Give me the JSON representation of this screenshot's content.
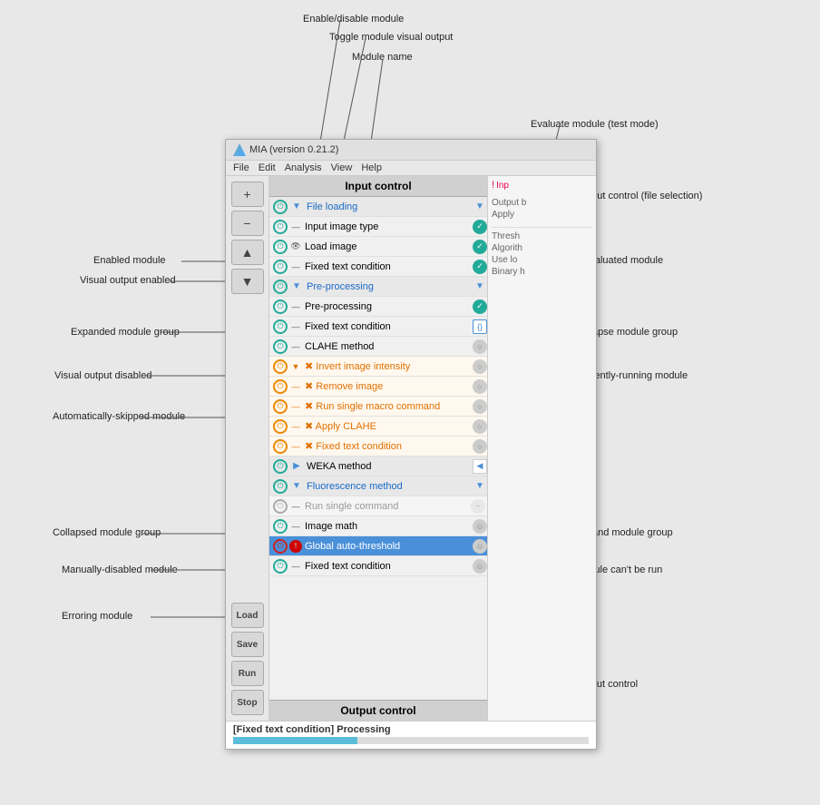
{
  "app": {
    "title": "MIA (version 0.21.2)",
    "menu": [
      "File",
      "Edit",
      "Analysis",
      "View",
      "Help"
    ]
  },
  "annotations": {
    "enable_disable": "Enable/disable module",
    "toggle_visual": "Toggle module visual output",
    "module_name": "Module name",
    "evaluate_module": "Evaluate module (test mode)",
    "input_control": "Input control (file selection)",
    "enabled_module": "Enabled module",
    "evaluated_module": "Evaluated module",
    "visual_output_enabled": "Visual output enabled",
    "expanded_module_group": "Expanded module group",
    "collapse_module_group": "Collapse module group",
    "visual_output_disabled": "Visual output disabled",
    "currently_running": "Currently-running module",
    "auto_skipped": "Automatically-skipped module",
    "collapsed_module_group": "Collapsed module group",
    "expand_module_group": "Expand module group",
    "manually_disabled": "Manually-disabled module",
    "module_cant_run": "Module can't be run",
    "erroring_module": "Erroring module",
    "output_control": "Output control"
  },
  "panels": {
    "input_control": "Input control",
    "output_control": "Output control"
  },
  "buttons": {
    "add": "+",
    "minus": "−",
    "up": "▲",
    "down": "▼",
    "load": "Load",
    "save": "Save",
    "run": "Run",
    "stop": "Stop"
  },
  "modules": [
    {
      "name": "File loading",
      "type": "group-header",
      "power": "green",
      "expand": "down-blue",
      "status": "down-blue"
    },
    {
      "name": "Input image type",
      "type": "normal",
      "power": "green",
      "expand": "dash",
      "status": "green-check"
    },
    {
      "name": "Load image",
      "type": "normal",
      "power": "green",
      "expand": "eye",
      "status": "green-check"
    },
    {
      "name": "Fixed text condition",
      "type": "normal",
      "power": "green",
      "expand": "dash",
      "status": "green-check"
    },
    {
      "name": "Pre-processing",
      "type": "group-header",
      "power": "green",
      "expand": "down-blue",
      "status": "down-blue"
    },
    {
      "name": "Pre-processing",
      "type": "normal",
      "power": "green",
      "expand": "dash",
      "status": "green-check"
    },
    {
      "name": "Fixed text condition",
      "type": "normal",
      "power": "green",
      "expand": "dash",
      "status": "blue-curly"
    },
    {
      "name": "CLAHE method",
      "type": "normal",
      "power": "green",
      "expand": "dash",
      "status": "gray"
    },
    {
      "name": "Invert image intensity",
      "type": "group-header-orange",
      "power": "orange",
      "expand": "down-orange",
      "status": "gray"
    },
    {
      "name": "Remove image",
      "type": "normal-orange",
      "power": "orange",
      "expand": "dash-orange",
      "status": "gray"
    },
    {
      "name": "Run single macro command",
      "type": "normal-orange",
      "power": "orange",
      "expand": "dash-orange",
      "status": "gray"
    },
    {
      "name": "Apply CLAHE",
      "type": "normal-orange",
      "power": "orange",
      "expand": "dash-orange",
      "status": "gray"
    },
    {
      "name": "Fixed text condition",
      "type": "normal-orange",
      "power": "orange",
      "expand": "dash-orange",
      "status": "gray"
    },
    {
      "name": "WEKA method",
      "type": "group-collapsed",
      "power": "green",
      "expand": "right-blue",
      "status": "collapse-left"
    },
    {
      "name": "Fluorescence method",
      "type": "group-header",
      "power": "green",
      "expand": "down-blue",
      "status": "down-blue"
    },
    {
      "name": "Run single command",
      "type": "disabled",
      "power": "disabled",
      "expand": "dash",
      "status": "gray-minus"
    },
    {
      "name": "Image math",
      "type": "normal",
      "power": "green",
      "expand": "dash",
      "status": "gray-smiley"
    },
    {
      "name": "Global auto-threshold",
      "type": "highlighted",
      "power": "red",
      "expand": "red-dash",
      "status": "gray-smiley"
    },
    {
      "name": "Fixed text condition",
      "type": "normal",
      "power": "green",
      "expand": "dash",
      "status": "gray-smiley"
    }
  ],
  "right_panel": {
    "error_label": "Inp",
    "output_label": "Output b",
    "apply_label": "Apply",
    "thresh_label": "Thresh",
    "algo_label": "Algorith",
    "use_low_label": "Use lo",
    "binary_label": "Binary h"
  },
  "status_bar": {
    "text": "[Fixed text condition] Processing"
  }
}
